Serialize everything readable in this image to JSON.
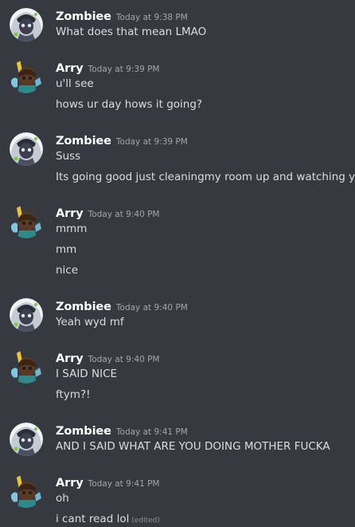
{
  "messages": [
    {
      "user": "Zombiee",
      "time": "Today at 9:38 PM",
      "avatar": "zombiee-avatar",
      "lines": [
        "What does that mean LMAO"
      ]
    },
    {
      "user": "Arry",
      "time": "Today at 9:39 PM",
      "avatar": "arry-avatar",
      "lines": [
        "u'll see",
        "hows ur day hows it going?"
      ]
    },
    {
      "user": "Zombiee",
      "time": "Today at 9:39 PM",
      "avatar": "zombiee-avatar",
      "lines": [
        "Suss",
        "Its going good just cleaningmy room up and watching yo"
      ]
    },
    {
      "user": "Arry",
      "time": "Today at 9:40 PM",
      "avatar": "arry-avatar",
      "lines": [
        "mmm",
        "mm",
        "nice"
      ]
    },
    {
      "user": "Zombiee",
      "time": "Today at 9:40 PM",
      "avatar": "zombiee-avatar",
      "lines": [
        "Yeah wyd mf"
      ]
    },
    {
      "user": "Arry",
      "time": "Today at 9:40 PM",
      "avatar": "arry-avatar",
      "lines": [
        "I SAID NICE",
        "ftym?!"
      ]
    },
    {
      "user": "Zombiee",
      "time": "Today at 9:41 PM",
      "avatar": "zombiee-avatar",
      "lines": [
        "AND I SAID WHAT ARE YOU DOING MOTHER FUCKA"
      ]
    },
    {
      "user": "Arry",
      "time": "Today at 9:41 PM",
      "avatar": "arry-avatar",
      "lines": [
        "oh",
        "i cant read lol"
      ],
      "edited_label": "(edited)"
    }
  ],
  "colors": {
    "background": "#36393f",
    "username": "#ffffff",
    "timestamp": "#a3a6aa",
    "message_text": "#dcddde",
    "edited": "#8e9297"
  }
}
